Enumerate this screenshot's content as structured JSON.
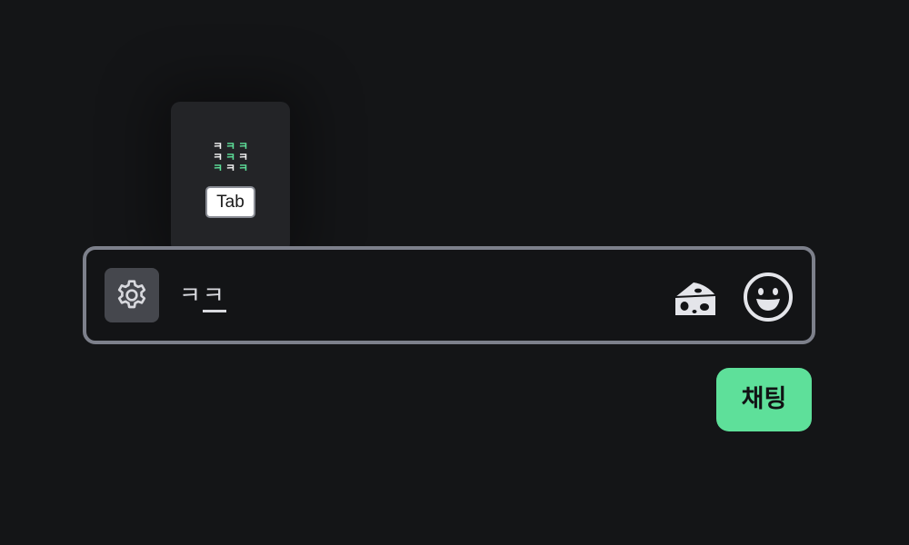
{
  "autocomplete": {
    "emote_rows": [
      [
        "ㅋ",
        "ㅋ",
        "ㅋ"
      ],
      [
        "ㅋ",
        "ㅋ",
        "ㅋ"
      ],
      [
        "ㅋ",
        "ㅋ",
        "ㅋ"
      ]
    ],
    "key_hint": "Tab"
  },
  "chat_input": {
    "committed_text": "ㅋ",
    "composing_text": "ㅋ",
    "settings_icon": "gear-icon",
    "cheese_icon": "cheese-icon",
    "emoji_icon": "smiley-icon"
  },
  "chat_button": {
    "label": "채팅"
  },
  "colors": {
    "accent": "#5ee09a",
    "background": "#141517",
    "input_border": "#7d808b",
    "popup_bg": "#232427"
  }
}
